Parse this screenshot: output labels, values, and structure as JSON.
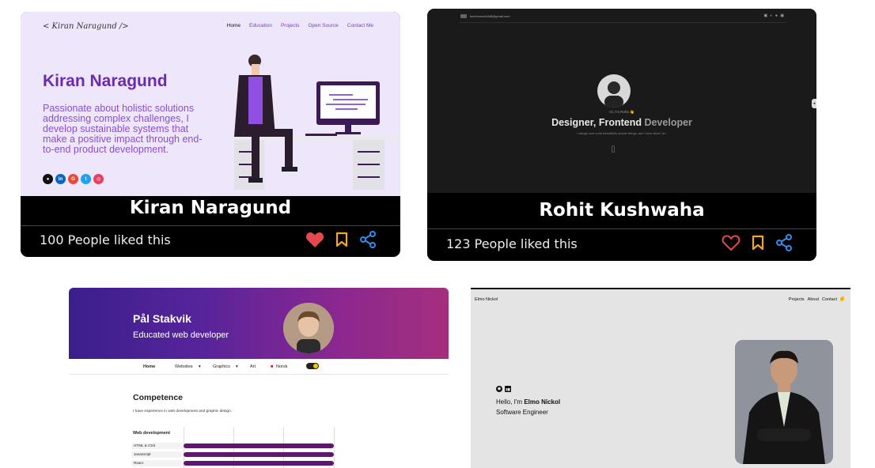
{
  "cards": [
    {
      "name": "Kiran Naragund",
      "likes": "100 People liked this",
      "preview": {
        "logo": "< Kiran Naragund />",
        "nav": [
          "Home",
          "Education",
          "Projects",
          "Open Source",
          "Contact Me"
        ],
        "title": "Kiran Naragund",
        "description": "Passionate about holistic solutions addressing complex challenges, I develop sustainable systems that make a positive impact through end-to-end product development.",
        "socials": [
          "github",
          "linkedin",
          "google",
          "twitter",
          "instagram"
        ]
      },
      "liked": true
    },
    {
      "name": "Rohit Kushwaha",
      "likes": "123 People liked this",
      "preview": {
        "email": "technoworld448@gmail.com",
        "greeting": "Hi, I'm Rohit 👋",
        "role_main": "Designer, Frontend",
        "role_dim": " Developer",
        "tagline": "I design and code beautifully simple things, and I love what I do."
      },
      "liked": false
    },
    {
      "preview": {
        "name": "Pål Stakvik",
        "subtitle": "Educated web developer",
        "nav": [
          "Home",
          "Websites",
          "Graphics",
          "Art",
          "Norsk"
        ],
        "section_title": "Competence",
        "section_text": "I have experience in web development and graphic design.",
        "group_title": "Web development",
        "skills": [
          {
            "label": "HTML & CSS",
            "level": 1.0
          },
          {
            "label": "JavaScript",
            "level": 1.0
          },
          {
            "label": "React",
            "level": 1.0
          }
        ]
      }
    },
    {
      "preview": {
        "brand": "Elmo Nickol",
        "nav": [
          "Projects",
          "About",
          "Contact"
        ],
        "hello_prefix": "Hello, I'm ",
        "hello_name": "Elmo Nickol",
        "role": "Software Engineer"
      }
    }
  ],
  "colors": {
    "heart_filled": "#e5484d",
    "heart_outline": "#e5484d",
    "bookmark": "#f5a623",
    "share": "#2f8fe8",
    "kiran_purple": "#6a2cae",
    "pal_bar": "#5f1670"
  }
}
